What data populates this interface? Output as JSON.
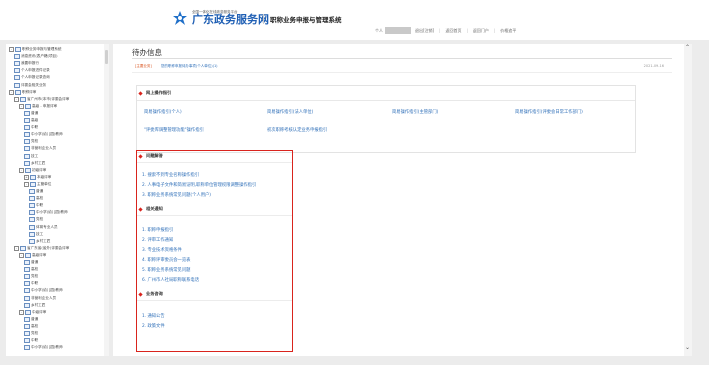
{
  "header": {
    "brand_small": "全国一体化在线政务服务平台",
    "brand_big": "广东政务服务网",
    "system_name": "职称业务申报与管理系统",
    "user_label": "个人",
    "nav": [
      "退出[注销]",
      "返回首页",
      "返回门户",
      "价格追平"
    ]
  },
  "sidebar": {
    "items": [
      {
        "label": "职称业务申报与管理系统",
        "level": 0,
        "toggle": "-"
      },
      {
        "label": "消息资讯(表户籍(项目)",
        "level": 1
      },
      {
        "label": "我要申报行",
        "level": 1
      },
      {
        "label": "个人申报进件记录",
        "level": 1
      },
      {
        "label": "个人申报记录查询",
        "level": 1
      },
      {
        "label": "评委会相关业务",
        "level": 1
      },
      {
        "label": "职称评审",
        "level": 0,
        "toggle": "-"
      },
      {
        "label": "省广州市(本市)评委会评审",
        "level": 1,
        "toggle": "-"
      },
      {
        "label": "高级 - 申报评审",
        "level": 2,
        "toggle": "-"
      },
      {
        "label": "普通",
        "level": 3
      },
      {
        "label": "高级",
        "level": 3
      },
      {
        "label": "中职",
        "level": 3
      },
      {
        "label": "中小学(幼儿园)教师",
        "level": 3
      },
      {
        "label": "党校",
        "level": 3
      },
      {
        "label": "非营利企业人员",
        "level": 3
      },
      {
        "label": "技工",
        "level": 3
      },
      {
        "label": "乡村工匠",
        "level": 3
      },
      {
        "label": "初级评审",
        "level": 2,
        "toggle": "-"
      },
      {
        "label": "本级评审",
        "level": 3,
        "toggle": "+"
      },
      {
        "label": "主管单位",
        "level": 3,
        "toggle": "-"
      },
      {
        "label": "普通",
        "level": 4
      },
      {
        "label": "高校",
        "level": 4
      },
      {
        "label": "中职",
        "level": 4
      },
      {
        "label": "中小学(幼儿园)教师",
        "level": 4
      },
      {
        "label": "党校",
        "level": 4
      },
      {
        "label": "体育专业人员",
        "level": 4
      },
      {
        "label": "技工",
        "level": 4
      },
      {
        "label": "乡村工匠",
        "level": 4
      },
      {
        "label": "省广东省(省外)评委会评审",
        "level": 1,
        "toggle": "-"
      },
      {
        "label": "高级评审",
        "level": 2,
        "toggle": "-"
      },
      {
        "label": "普通",
        "level": 3
      },
      {
        "label": "高校",
        "level": 3
      },
      {
        "label": "党校",
        "level": 3
      },
      {
        "label": "中职",
        "level": 3
      },
      {
        "label": "中小学(幼儿园)教师",
        "level": 3
      },
      {
        "label": "非营利企业人员",
        "level": 3
      },
      {
        "label": "乡村工匠",
        "level": 3
      },
      {
        "label": "中级评审",
        "level": 2,
        "toggle": "-"
      },
      {
        "label": "普通",
        "level": 3
      },
      {
        "label": "高校",
        "level": 3
      },
      {
        "label": "党校",
        "level": 3
      },
      {
        "label": "中职",
        "level": 3
      },
      {
        "label": "中小学(幼儿园)教师",
        "level": 3
      }
    ]
  },
  "main": {
    "title": "待办信息",
    "notice": {
      "tag": "[主要业务]",
      "text": "您的职称申报待办事项(个人单位)(1)",
      "date": "2021-09-16"
    },
    "guide": {
      "heading": "网上操作指引",
      "links_row1": [
        "简易操作指引(个人)",
        "简易操作指引(法人单位)",
        "简易操作指引(主管部门)",
        "简易操作指引(评委会日常工作部门)"
      ],
      "links_row2": [
        "\"评委库调整管理功能\"操作指引",
        "初次职称考核认定业务申报指引"
      ]
    },
    "faq": {
      "heading": "问题解答",
      "items": [
        "1. 搜索不到专业名称操作指引",
        "2. 人事电子文件和简易证明,职称单位管理权限调整操作指引",
        "3. 职称业务系统常见问题(个人用户)"
      ]
    },
    "notices": {
      "heading": "相关通知",
      "items": [
        "1. 职称申报指引",
        "2. 评审工作通知",
        "3. 专业技术资格条件",
        "4. 职称评审委员会一览表",
        "5. 职称业务系统常见问题",
        "6. 广州市人社局职称联系电话"
      ]
    },
    "consult": {
      "heading": "业务咨询",
      "items": [
        "1. 通知公告",
        "2. 政策文件"
      ]
    }
  }
}
